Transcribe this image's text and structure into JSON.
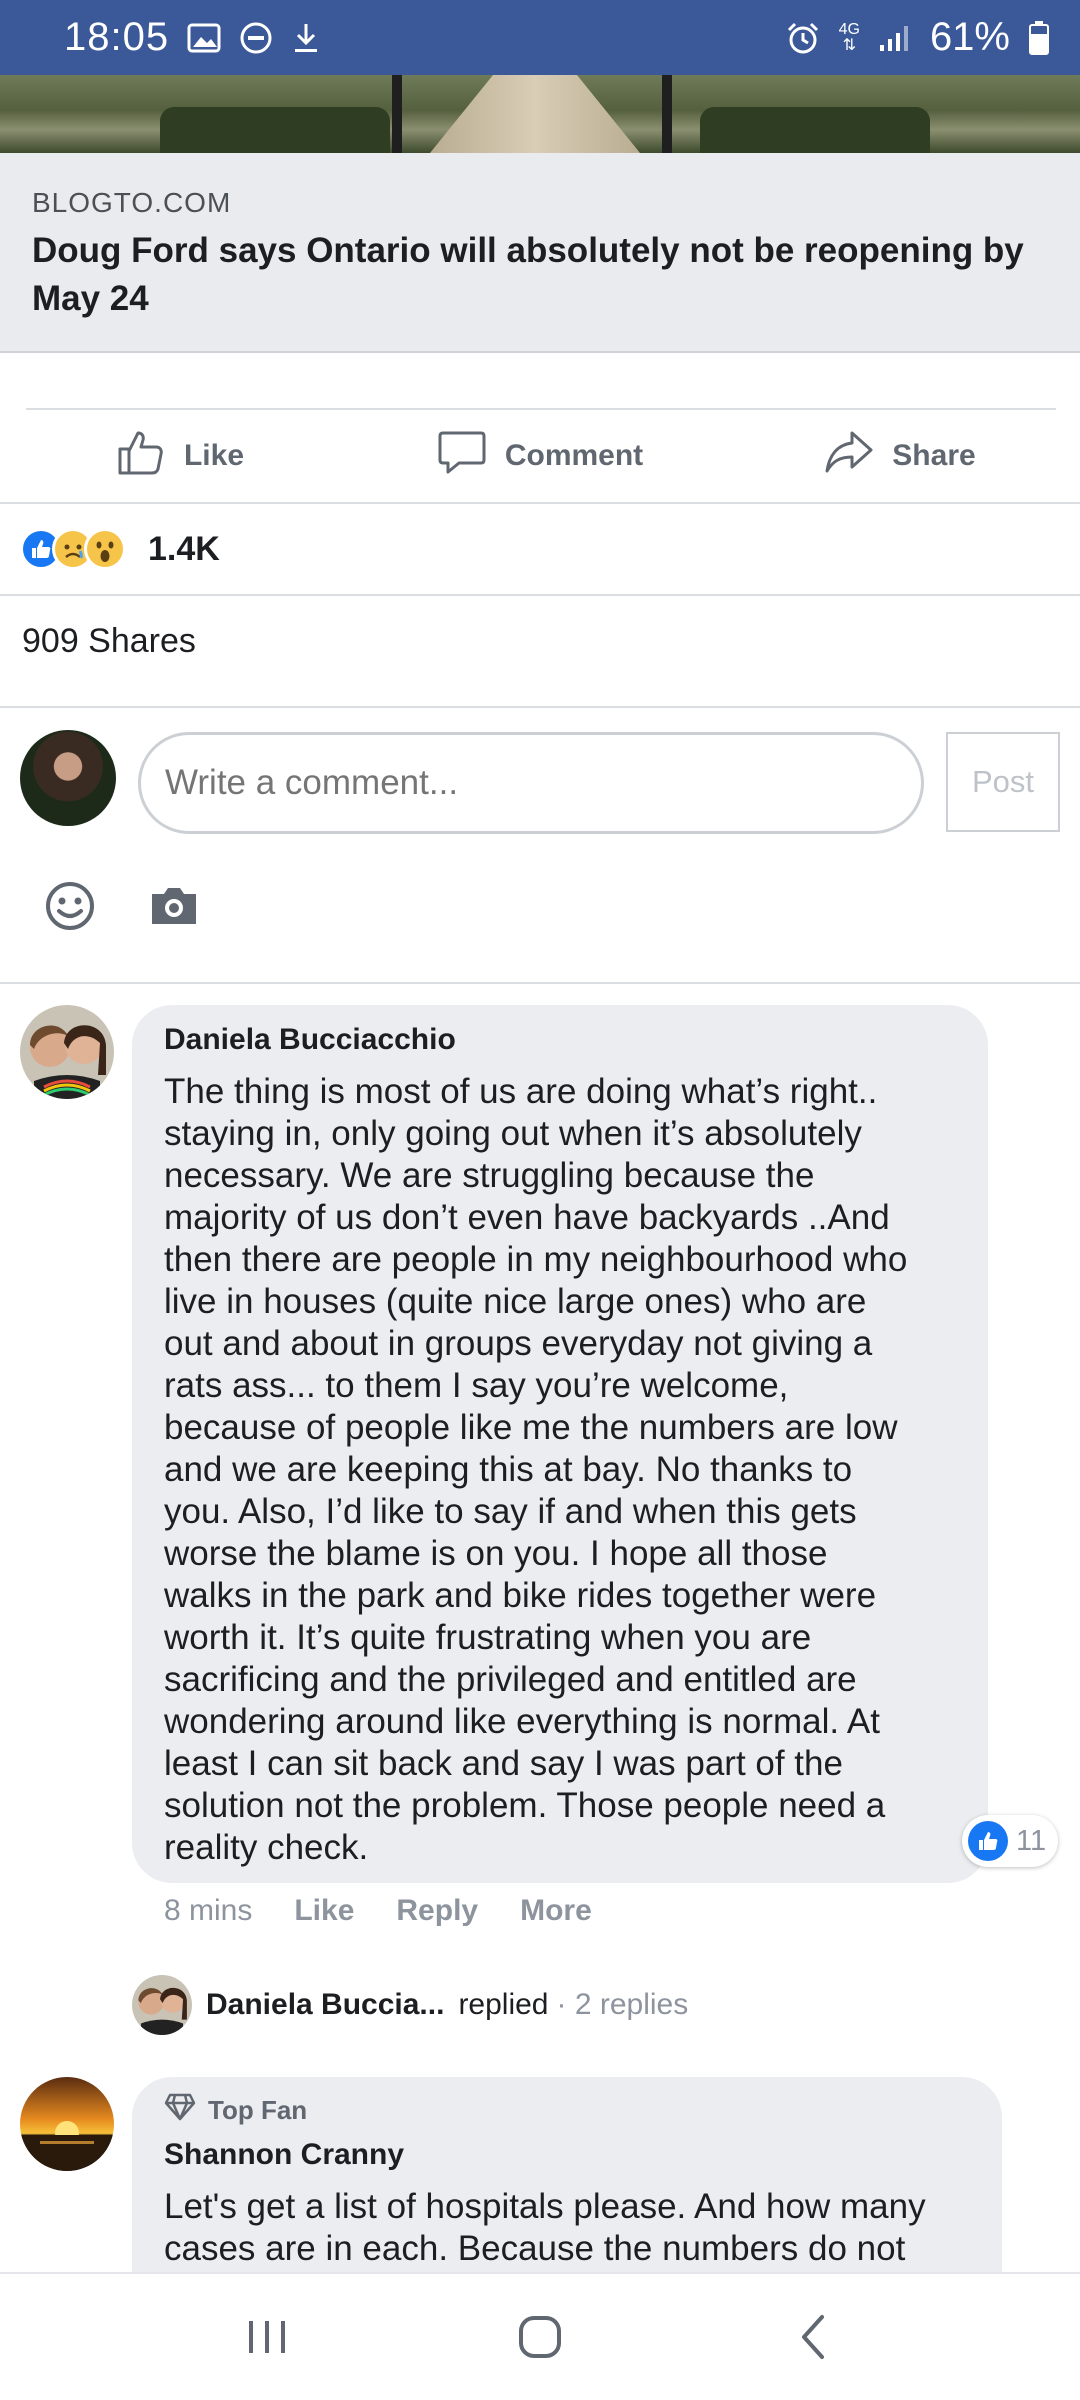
{
  "status_bar": {
    "time": "18:05",
    "battery": "61%",
    "network": "4G"
  },
  "link_preview": {
    "domain": "BLOGTO.COM",
    "title": "Doug Ford says Ontario will absolutely not be reopening by May 24"
  },
  "actions": {
    "like_label": "Like",
    "comment_label": "Comment",
    "share_label": "Share"
  },
  "reactions": {
    "count": "1.4K",
    "icons": [
      "like-icon",
      "sad-icon",
      "wow-icon"
    ]
  },
  "shares": "909 Shares",
  "composer": {
    "placeholder": "Write a comment...",
    "post_label": "Post"
  },
  "comments": [
    {
      "author": "Daniela Bucciacchio",
      "lines": [
        "The thing is most of us are doing what’s right..",
        "staying in, only going out when it’s absolutely",
        "necessary. We are struggling because the",
        "majority of us don’t even have backyards ..And",
        "then there are people in my neighbourhood who",
        "live in houses (quite nice large ones) who are",
        "out and about in groups everyday not giving a",
        "rats ass... to them I say you’re welcome,",
        "because of people like me the numbers are low",
        "and we are keeping this at bay. No thanks to",
        "you. Also, I’d like to say if and when this gets",
        "worse the blame is on you. I hope all those",
        "walks in the park and bike rides together were",
        "worth it. It’s quite frustrating when you are",
        "sacrificing and the privileged and entitled are",
        "wondering around like everything is normal. At",
        "least I can sit back and say I was part of the",
        "solution not the problem. Those people need a",
        "reality check."
      ],
      "time": "8 mins",
      "like_label": "Like",
      "reply_label": "Reply",
      "more_label": "More",
      "likes": "11",
      "replies": {
        "name": "Daniela Buccia...",
        "verb": "replied",
        "count": "· 2 replies"
      }
    },
    {
      "badge": "Top Fan",
      "author": "Shannon Cranny",
      "lines": [
        "Let's get a list of hospitals please. And how many",
        "cases are in each. Because the numbers do not"
      ]
    }
  ]
}
